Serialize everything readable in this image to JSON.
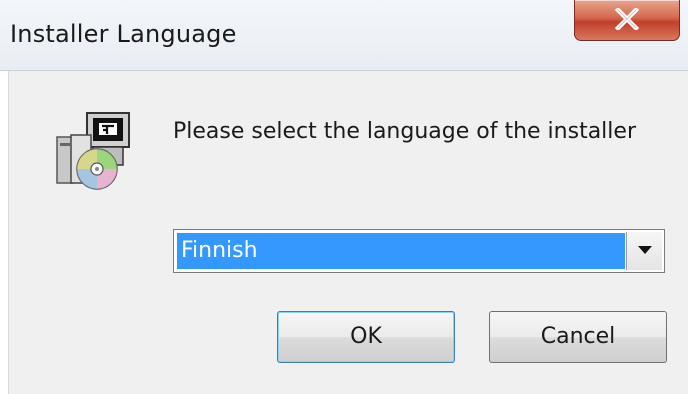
{
  "window": {
    "title": "Installer Language",
    "close_icon": "close-icon"
  },
  "dialog": {
    "app_icon": "installer-cd-icon",
    "prompt": "Please select the language of the installer",
    "language_select": {
      "selected": "Finnish",
      "arrow_icon": "chevron-down-icon"
    },
    "ok_label": "OK",
    "cancel_label": "Cancel"
  },
  "colors": {
    "selection": "#3399ff",
    "close_button": "#c9452c",
    "dialog_background": "#f0f0f0"
  }
}
